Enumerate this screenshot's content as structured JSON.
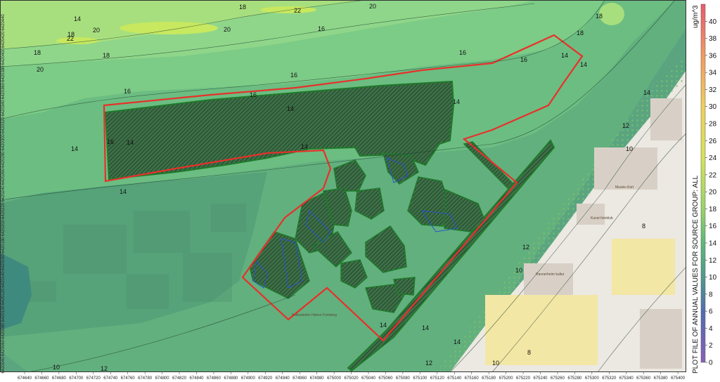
{
  "legend": {
    "title": "PLOT FILE OF ANNUAL VALUES FOR SOURCE GROUP: ALL",
    "unit": "ug/m^3",
    "range": [
      0,
      42
    ],
    "ticks": [
      0,
      2,
      4,
      6,
      8,
      10,
      12,
      14,
      16,
      18,
      20,
      22,
      24,
      26,
      28,
      30,
      32,
      34,
      36,
      38,
      40
    ],
    "stops": [
      {
        "value": 0,
        "color": "#8a5fb8"
      },
      {
        "value": 6,
        "color": "#4f6fb0"
      },
      {
        "value": 10,
        "color": "#4f9a8c"
      },
      {
        "value": 14,
        "color": "#5fb878"
      },
      {
        "value": 18,
        "color": "#98d36a"
      },
      {
        "value": 24,
        "color": "#d6e35a"
      },
      {
        "value": 30,
        "color": "#f0cf5a"
      },
      {
        "value": 36,
        "color": "#f29a63"
      },
      {
        "value": 42,
        "color": "#e85a6e"
      }
    ]
  },
  "contour_labels": [
    "22",
    "18",
    "14",
    "18",
    "20",
    "20",
    "16",
    "18",
    "22",
    "20",
    "18",
    "20",
    "16",
    "18",
    "16",
    "18",
    "16",
    "16",
    "16",
    "14",
    "16",
    "14",
    "14",
    "14",
    "14",
    "14",
    "14",
    "12",
    "10",
    "8",
    "12",
    "10",
    "8",
    "14",
    "12",
    "10",
    "14",
    "14",
    "14",
    "12",
    "10",
    "14"
  ],
  "x_axis_ticks": [
    "674640",
    "674660",
    "674680",
    "674700",
    "674720",
    "674740",
    "674760",
    "674780",
    "674800",
    "674820",
    "674840",
    "674860",
    "674880",
    "674900",
    "674920",
    "674940",
    "674960",
    "674980",
    "675000",
    "675020",
    "675040",
    "675060",
    "675080",
    "675100",
    "675120",
    "675140",
    "675160",
    "675180",
    "675200",
    "675220",
    "675240",
    "675260",
    "675280",
    "675300",
    "675320",
    "675340",
    "675360",
    "675380",
    "675400"
  ],
  "y_axis_ticks": [
    "6420440",
    "6420420",
    "6420400",
    "6420380",
    "6420360",
    "6420340",
    "6420320",
    "6420300",
    "6420280",
    "6420260",
    "6420240",
    "6420220",
    "6420200",
    "6420180",
    "6420160",
    "6420140",
    "6420120",
    "6420100",
    "6420080",
    "6420060",
    "6420040"
  ],
  "place_labels": [
    "Musée d'art",
    "Kunst\nfotoklub",
    "Folkeskolen\nHalvor Forsberg",
    "Ravnerheim\nkultur"
  ],
  "colors": {
    "site_boundary": "#e8302a",
    "source_area_outline": "#1f7a2a",
    "building_outline": "#2a52c8",
    "urban_bg": "#ece8e2",
    "building_fill": "#d8d0c6"
  }
}
